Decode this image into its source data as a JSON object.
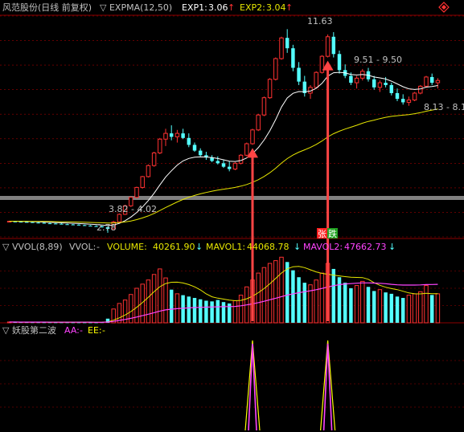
{
  "colors": {
    "bg": "#000000",
    "up": "#ff3232",
    "down": "#54ffff",
    "grid": "#8b0000",
    "exp1": "#ffffff",
    "exp2": "#e6e600",
    "vol_line": "#ff44ff",
    "mavol1": "#ffffff",
    "mavol2": "#e6e600",
    "label": "#c0c0c0",
    "aa": "#ff44ff",
    "ee": "#ffff00",
    "arrow": "#ff4444",
    "dashed": "#a00000"
  },
  "header": {
    "stock": "风范股份(日线 前复权)",
    "indicator": "▽ EXPMA(12,50)",
    "exp1_label": "EXP1:",
    "exp1_value": "3.06",
    "exp2_label": "EXP2:",
    "exp2_value": "3.04",
    "diamond_icon": "diamond-icon"
  },
  "price_annotations": {
    "high": "11.63",
    "mid": "9.51 - 9.50",
    "right": "8.13 - 8.1",
    "low_range": "3.82 - 4.02",
    "low": "2.78"
  },
  "volume_panel": {
    "title": "▽ VVOL(8,89)",
    "vvol_label": "VVOL:",
    "vvol_value": "-",
    "volume_label": "VOLUME:",
    "volume_value": "40261.90",
    "mavol1_label": "MAVOL1:",
    "mavol1_value": "44068.78",
    "mavol2_label": "MAVOL2:",
    "mavol2_value": "47662.73",
    "tag_rise": "张",
    "tag_fall": "跌"
  },
  "bottom_panel": {
    "title": "▽ 妖股第二波",
    "aa_label": "AA:",
    "aa_value": "-",
    "ee_label": "EE:",
    "ee_value": "-"
  },
  "price_axis": {
    "min": 2.6,
    "max": 12.2
  },
  "candles": [
    [
      3.28,
      3.3,
      3.25,
      3.28
    ],
    [
      3.27,
      3.29,
      3.24,
      3.26
    ],
    [
      3.26,
      3.28,
      3.24,
      3.25
    ],
    [
      3.25,
      3.27,
      3.23,
      3.24
    ],
    [
      3.24,
      3.26,
      3.21,
      3.22
    ],
    [
      3.22,
      3.24,
      3.2,
      3.21
    ],
    [
      3.21,
      3.23,
      3.18,
      3.19
    ],
    [
      3.19,
      3.21,
      3.17,
      3.18
    ],
    [
      3.18,
      3.2,
      3.16,
      3.17
    ],
    [
      3.17,
      3.19,
      3.14,
      3.15
    ],
    [
      3.15,
      3.17,
      3.13,
      3.14
    ],
    [
      3.14,
      3.16,
      3.12,
      3.13
    ],
    [
      3.13,
      3.15,
      3.1,
      3.11
    ],
    [
      3.11,
      3.13,
      3.08,
      3.09
    ],
    [
      3.09,
      3.11,
      3.06,
      3.07
    ],
    [
      3.07,
      3.1,
      3.05,
      3.06
    ],
    [
      3.06,
      3.08,
      3.0,
      3.02
    ],
    [
      3.02,
      3.04,
      2.78,
      2.95
    ],
    [
      2.95,
      3.3,
      2.93,
      3.25
    ],
    [
      3.25,
      3.62,
      3.22,
      3.58
    ],
    [
      3.58,
      4.0,
      3.55,
      3.95
    ],
    [
      3.95,
      4.35,
      3.9,
      4.32
    ],
    [
      4.32,
      4.78,
      4.28,
      4.75
    ],
    [
      4.75,
      5.25,
      4.7,
      5.22
    ],
    [
      5.22,
      5.75,
      5.18,
      5.7
    ],
    [
      5.7,
      6.3,
      5.65,
      6.25
    ],
    [
      6.25,
      6.9,
      6.2,
      6.85
    ],
    [
      6.85,
      7.3,
      6.55,
      7.1
    ],
    [
      7.1,
      7.45,
      6.8,
      6.95
    ],
    [
      6.95,
      7.25,
      6.7,
      7.1
    ],
    [
      7.1,
      7.3,
      6.85,
      6.9
    ],
    [
      6.9,
      7.1,
      6.5,
      6.6
    ],
    [
      6.6,
      6.7,
      6.3,
      6.35
    ],
    [
      6.35,
      6.45,
      6.1,
      6.15
    ],
    [
      6.15,
      6.3,
      5.95,
      6.05
    ],
    [
      6.05,
      6.15,
      5.85,
      5.9
    ],
    [
      5.9,
      6.1,
      5.75,
      5.8
    ],
    [
      5.8,
      5.95,
      5.6,
      5.65
    ],
    [
      5.65,
      5.9,
      5.45,
      5.55
    ],
    [
      5.55,
      5.85,
      5.5,
      5.8
    ],
    [
      5.8,
      6.2,
      5.75,
      6.15
    ],
    [
      6.15,
      6.7,
      6.1,
      6.65
    ],
    [
      6.65,
      7.3,
      6.6,
      7.25
    ],
    [
      7.25,
      7.95,
      7.2,
      7.9
    ],
    [
      7.9,
      8.7,
      7.85,
      8.65
    ],
    [
      8.65,
      9.5,
      8.6,
      9.45
    ],
    [
      9.45,
      10.4,
      9.4,
      10.35
    ],
    [
      10.35,
      11.3,
      10.3,
      11.25
    ],
    [
      11.25,
      11.63,
      10.6,
      10.8
    ],
    [
      10.8,
      10.95,
      9.8,
      9.95
    ],
    [
      9.95,
      10.2,
      9.2,
      9.35
    ],
    [
      9.35,
      9.6,
      8.7,
      8.85
    ],
    [
      8.85,
      9.2,
      8.6,
      9.1
    ],
    [
      9.1,
      9.8,
      9.05,
      9.75
    ],
    [
      9.75,
      10.5,
      9.7,
      10.45
    ],
    [
      10.45,
      11.4,
      10.4,
      11.3
    ],
    [
      11.3,
      11.5,
      10.4,
      10.55
    ],
    [
      10.55,
      10.7,
      9.7,
      9.85
    ],
    [
      9.85,
      10.1,
      9.5,
      9.6
    ],
    [
      9.6,
      9.75,
      9.2,
      9.3
    ],
    [
      9.3,
      9.6,
      9.05,
      9.5
    ],
    [
      9.5,
      9.9,
      9.4,
      9.8
    ],
    [
      9.8,
      9.95,
      9.35,
      9.45
    ],
    [
      9.45,
      9.6,
      9.0,
      9.1
    ],
    [
      9.1,
      9.4,
      8.9,
      9.3
    ],
    [
      9.3,
      9.55,
      9.1,
      9.2
    ],
    [
      9.2,
      9.3,
      8.75,
      8.85
    ],
    [
      8.85,
      9.05,
      8.5,
      8.6
    ],
    [
      8.6,
      8.8,
      8.35,
      8.45
    ],
    [
      8.45,
      8.7,
      8.3,
      8.55
    ],
    [
      8.55,
      8.9,
      8.5,
      8.85
    ],
    [
      8.85,
      9.2,
      8.8,
      9.15
    ],
    [
      9.15,
      9.6,
      9.1,
      9.55
    ],
    [
      9.55,
      9.7,
      9.2,
      9.3
    ],
    [
      9.3,
      9.5,
      9.05,
      9.4
    ]
  ],
  "volume_axis": {
    "max": 100000
  },
  "volumes": [
    1200,
    1100,
    1000,
    1000,
    900,
    900,
    850,
    850,
    800,
    800,
    800,
    750,
    750,
    700,
    700,
    700,
    900,
    6000,
    20000,
    28000,
    33000,
    41000,
    50000,
    56000,
    62000,
    70000,
    78000,
    65000,
    48000,
    42000,
    40000,
    38000,
    36000,
    34000,
    32000,
    31000,
    33000,
    30000,
    28000,
    32000,
    40000,
    52000,
    62000,
    72000,
    80000,
    86000,
    90000,
    95000,
    88000,
    76000,
    66000,
    58000,
    55000,
    62000,
    72000,
    86000,
    78000,
    66000,
    58000,
    50000,
    54000,
    60000,
    52000,
    46000,
    48000,
    44000,
    42000,
    38000,
    36000,
    40000,
    42000,
    45000,
    54000,
    40261.9,
    42000
  ],
  "signal_points": [
    {
      "index": 42,
      "aa": 100,
      "ee": 100
    },
    {
      "index": 55,
      "aa": 100,
      "ee": 100
    }
  ]
}
